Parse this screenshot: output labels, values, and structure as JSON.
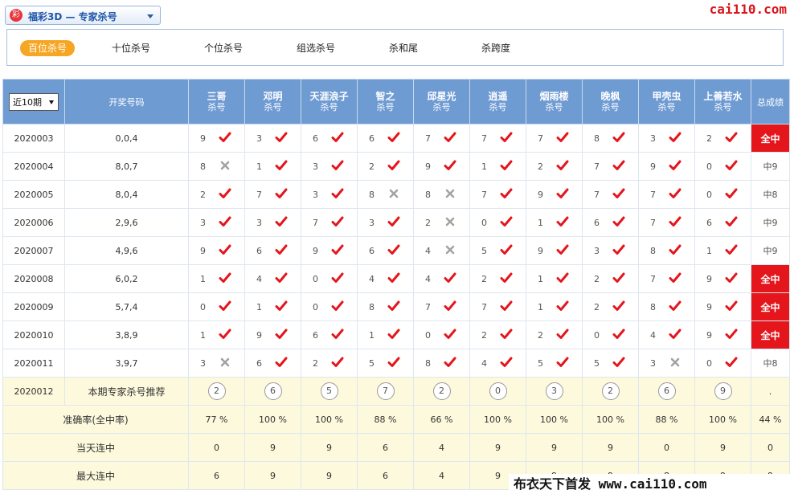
{
  "header": {
    "logo_glyph": "彩",
    "title": "福彩3D — 专家杀号",
    "brand": "cai110.com"
  },
  "tabs": [
    {
      "label": "百位杀号",
      "active": true
    },
    {
      "label": "十位杀号",
      "active": false
    },
    {
      "label": "个位杀号",
      "active": false
    },
    {
      "label": "组选杀号",
      "active": false
    },
    {
      "label": "杀和尾",
      "active": false
    },
    {
      "label": "杀跨度",
      "active": false
    }
  ],
  "table": {
    "period_select": "近10期",
    "col_draw": "开奖号码",
    "col_total": "总成绩",
    "experts": [
      {
        "name": "三哥",
        "sub": "杀号"
      },
      {
        "name": "邓明",
        "sub": "杀号"
      },
      {
        "name": "天涯浪子",
        "sub": "杀号"
      },
      {
        "name": "智之",
        "sub": "杀号"
      },
      {
        "name": "邱星光",
        "sub": "杀号"
      },
      {
        "name": "逍遥",
        "sub": "杀号"
      },
      {
        "name": "烟雨楼",
        "sub": "杀号"
      },
      {
        "name": "晚枫",
        "sub": "杀号"
      },
      {
        "name": "甲壳虫",
        "sub": "杀号"
      },
      {
        "name": "上善若水",
        "sub": "杀号"
      }
    ],
    "rows": [
      {
        "issue": "2020003",
        "draw": "0,0,4",
        "picks": [
          "9",
          "3",
          "6",
          "6",
          "7",
          "7",
          "7",
          "8",
          "3",
          "2"
        ],
        "hits": [
          1,
          1,
          1,
          1,
          1,
          1,
          1,
          1,
          1,
          1
        ],
        "total": "全中",
        "full": true
      },
      {
        "issue": "2020004",
        "draw": "8,0,7",
        "picks": [
          "8",
          "1",
          "3",
          "2",
          "9",
          "1",
          "2",
          "7",
          "9",
          "0"
        ],
        "hits": [
          0,
          1,
          1,
          1,
          1,
          1,
          1,
          1,
          1,
          1
        ],
        "total": "中9",
        "full": false
      },
      {
        "issue": "2020005",
        "draw": "8,0,4",
        "picks": [
          "2",
          "7",
          "3",
          "8",
          "8",
          "7",
          "9",
          "7",
          "7",
          "0"
        ],
        "hits": [
          1,
          1,
          1,
          0,
          0,
          1,
          1,
          1,
          1,
          1
        ],
        "total": "中8",
        "full": false
      },
      {
        "issue": "2020006",
        "draw": "2,9,6",
        "picks": [
          "3",
          "3",
          "7",
          "3",
          "2",
          "0",
          "1",
          "6",
          "7",
          "6"
        ],
        "hits": [
          1,
          1,
          1,
          1,
          0,
          1,
          1,
          1,
          1,
          1
        ],
        "total": "中9",
        "full": false
      },
      {
        "issue": "2020007",
        "draw": "4,9,6",
        "picks": [
          "9",
          "6",
          "9",
          "6",
          "4",
          "5",
          "9",
          "3",
          "8",
          "1"
        ],
        "hits": [
          1,
          1,
          1,
          1,
          0,
          1,
          1,
          1,
          1,
          1
        ],
        "total": "中9",
        "full": false
      },
      {
        "issue": "2020008",
        "draw": "6,0,2",
        "picks": [
          "1",
          "4",
          "0",
          "4",
          "4",
          "2",
          "1",
          "2",
          "7",
          "9"
        ],
        "hits": [
          1,
          1,
          1,
          1,
          1,
          1,
          1,
          1,
          1,
          1
        ],
        "total": "全中",
        "full": true
      },
      {
        "issue": "2020009",
        "draw": "5,7,4",
        "picks": [
          "0",
          "1",
          "0",
          "8",
          "7",
          "7",
          "1",
          "2",
          "8",
          "9"
        ],
        "hits": [
          1,
          1,
          1,
          1,
          1,
          1,
          1,
          1,
          1,
          1
        ],
        "total": "全中",
        "full": true
      },
      {
        "issue": "2020010",
        "draw": "3,8,9",
        "picks": [
          "1",
          "9",
          "6",
          "1",
          "0",
          "2",
          "2",
          "0",
          "4",
          "9"
        ],
        "hits": [
          1,
          1,
          1,
          1,
          1,
          1,
          1,
          1,
          1,
          1
        ],
        "total": "全中",
        "full": true
      },
      {
        "issue": "2020011",
        "draw": "3,9,7",
        "picks": [
          "3",
          "6",
          "2",
          "5",
          "8",
          "4",
          "5",
          "5",
          "3",
          "0"
        ],
        "hits": [
          0,
          1,
          1,
          1,
          1,
          1,
          1,
          1,
          0,
          1
        ],
        "total": "中8",
        "full": false
      }
    ],
    "recommend": {
      "issue": "2020012",
      "label": "本期专家杀号推荐",
      "nums": [
        "2",
        "6",
        "5",
        "7",
        "2",
        "0",
        "3",
        "2",
        "6",
        "9"
      ],
      "total": "."
    },
    "stats": [
      {
        "label": "准确率(全中率)",
        "values": [
          "77 %",
          "100 %",
          "100 %",
          "88 %",
          "66 %",
          "100 %",
          "100 %",
          "100 %",
          "88 %",
          "100 %"
        ],
        "total": "44 %"
      },
      {
        "label": "当天连中",
        "values": [
          "0",
          "9",
          "9",
          "6",
          "4",
          "9",
          "9",
          "9",
          "0",
          "9"
        ],
        "total": "0"
      },
      {
        "label": "最大连中",
        "values": [
          "6",
          "9",
          "9",
          "6",
          "4",
          "9",
          "9",
          "9",
          "8",
          "9"
        ],
        "total": "9"
      }
    ]
  },
  "watermark": "布衣天下首发 www.cai110.com",
  "colors": {
    "header_blue": "#6f9bd3",
    "hit_red": "#e4161c",
    "tab_orange": "#f6a623",
    "yellow_row": "#fdf9dc"
  }
}
